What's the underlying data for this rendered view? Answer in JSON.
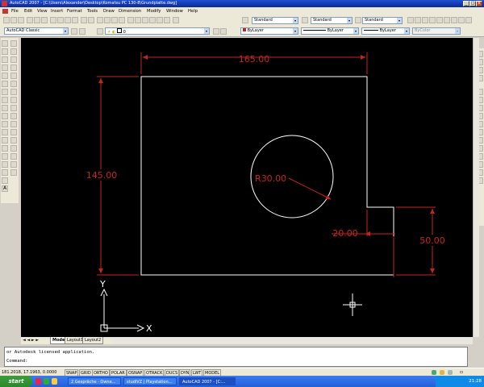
{
  "window": {
    "title": "AutoCAD 2007 - [C:\\Users\\Alexander\\Desktop\\Komatsu PC 130-8\\Grundplatte.dwg]",
    "min": "_",
    "max": "□",
    "close": "x"
  },
  "menu": [
    "File",
    "Edit",
    "View",
    "Insert",
    "Format",
    "Tools",
    "Draw",
    "Dimension",
    "Modify",
    "Window",
    "Help"
  ],
  "toolbar": {
    "workspace": "AutoCAD Classic",
    "layer": "0",
    "color": "ByLayer",
    "linetype": "ByLayer",
    "lineweight": "ByLayer",
    "plotstyle": "ByColor",
    "textstyle": "Standard",
    "dimstyle": "Standard",
    "tablestyle": "Standard"
  },
  "drawing": {
    "dim_width": "165.00",
    "dim_height": "145.00",
    "dim_radius": "R30.00",
    "dim_notch_w": "20.00",
    "dim_notch_h": "50.00",
    "ucs_y": "Y",
    "ucs_x": "X",
    "colors": {
      "dimension": "#c8221e",
      "geometry": "#ffffff",
      "background": "#000000"
    }
  },
  "layout_tabs": [
    "Model",
    "Layout1",
    "Layout2"
  ],
  "command": {
    "line1": "or Autodesk licensed application.",
    "prompt": "Command:"
  },
  "status": {
    "coords": "181.2018, 17.1963, 0.0000",
    "buttons": [
      "SNAP",
      "GRID",
      "ORTHO",
      "POLAR",
      "OSNAP",
      "OTRACK",
      "DUCS",
      "DYN",
      "LWT",
      "MODEL"
    ]
  },
  "taskbar": {
    "start": "start",
    "tasks": [
      "2 Gespräche · Owne...",
      "studiVZ | Playstation...",
      "AutoCAD 2007 - [C:..."
    ],
    "clock": "21:28"
  }
}
